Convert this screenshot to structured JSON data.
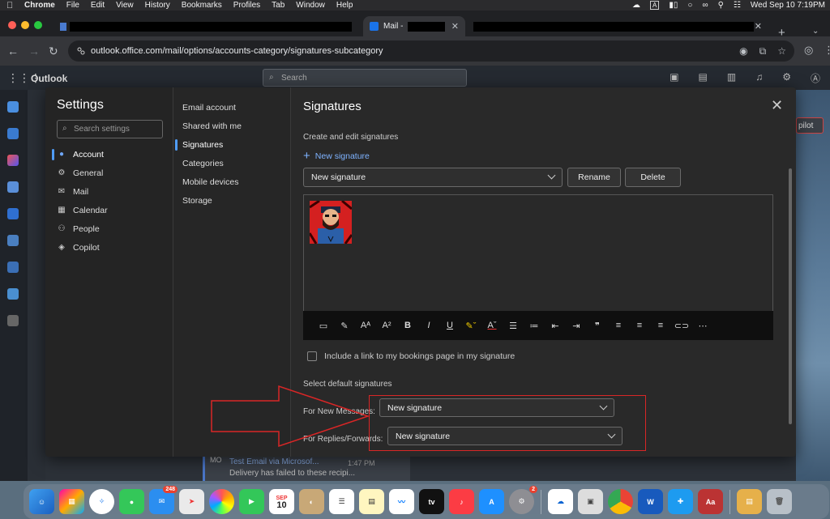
{
  "menubar": {
    "app": "Chrome",
    "items": [
      "File",
      "Edit",
      "View",
      "History",
      "Bookmarks",
      "Profiles",
      "Tab",
      "Window",
      "Help"
    ],
    "input_source": "A",
    "datetime": "Wed Sep 10  7:19PM"
  },
  "browser": {
    "tab_active_label": "Mail -",
    "url": "outlook.office.com/mail/options/accounts-category/signatures-subcategory"
  },
  "outlook": {
    "app_title": "Outlook",
    "search_placeholder": "Search",
    "copilot_chip": "pilot",
    "bottom_mail": {
      "avatar": "MO",
      "sender": "Test Email via Microsof...",
      "time": "1:47 PM",
      "preview": "Delivery has failed to these recipi..."
    }
  },
  "settings": {
    "title": "Settings",
    "search_placeholder": "Search settings",
    "nav": [
      {
        "label": "Account",
        "icon": "person-icon"
      },
      {
        "label": "General",
        "icon": "gear-icon"
      },
      {
        "label": "Mail",
        "icon": "mail-icon"
      },
      {
        "label": "Calendar",
        "icon": "calendar-icon"
      },
      {
        "label": "People",
        "icon": "people-icon"
      },
      {
        "label": "Copilot",
        "icon": "copilot-icon"
      }
    ],
    "subnav": [
      "Email account",
      "Shared with me",
      "Signatures",
      "Categories",
      "Mobile devices",
      "Storage"
    ],
    "selected_nav": "Account",
    "selected_subnav": "Signatures"
  },
  "signatures": {
    "title": "Signatures",
    "subtitle": "Create and edit signatures",
    "new_signature_link": "New signature",
    "selected_signature": "New signature",
    "rename_button": "Rename",
    "delete_button": "Delete",
    "bookings_checkbox_label": "Include a link to my bookings page in my signature",
    "bookings_checked": false,
    "default_section_label": "Select default signatures",
    "for_new_messages_label": "For New Messages:",
    "for_new_messages_value": "New signature",
    "for_replies_label": "For Replies/Forwards:",
    "for_replies_value": "New signature"
  },
  "dock": {
    "mail_badge": "248",
    "calendar_month": "SEP",
    "calendar_day": "10",
    "settings_badge": "2",
    "tv_label": "tv",
    "word_label": "W",
    "dictionary_label": "Aa"
  },
  "colors": {
    "accent": "#4f9cf7",
    "annotation_red": "#d92626"
  }
}
